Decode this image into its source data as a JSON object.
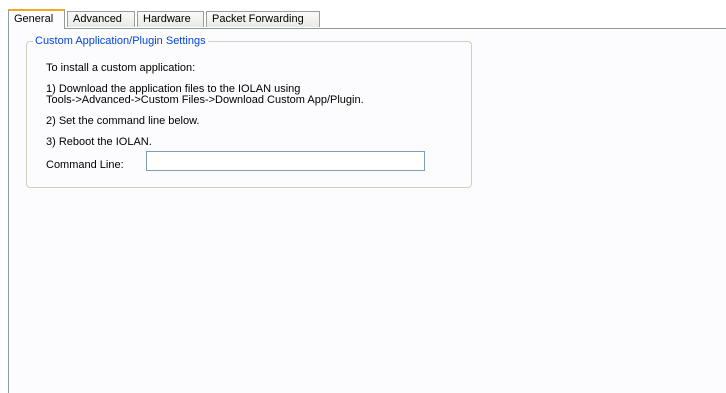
{
  "tabs": [
    {
      "label": "General",
      "active": true
    },
    {
      "label": "Advanced",
      "active": false
    },
    {
      "label": "Hardware",
      "active": false
    },
    {
      "label": "Packet Forwarding",
      "active": false
    }
  ],
  "group": {
    "title": "Custom Application/Plugin Settings",
    "intro": "To install a custom application:",
    "step1_line1": "1) Download the application files to the IOLAN using",
    "step1_line2": "Tools->Advanced->Custom Files->Download Custom App/Plugin.",
    "step2": "2) Set the command line below.",
    "step3": "3) Reboot the IOLAN.",
    "command_line_label": "Command Line:",
    "command_line_value": "",
    "command_line_placeholder": ""
  },
  "colors": {
    "group_title": "#0046d5",
    "active_tab_accent": "#f5a623",
    "panel_background": "#fcfcfe",
    "input_border": "#7f9db9"
  }
}
